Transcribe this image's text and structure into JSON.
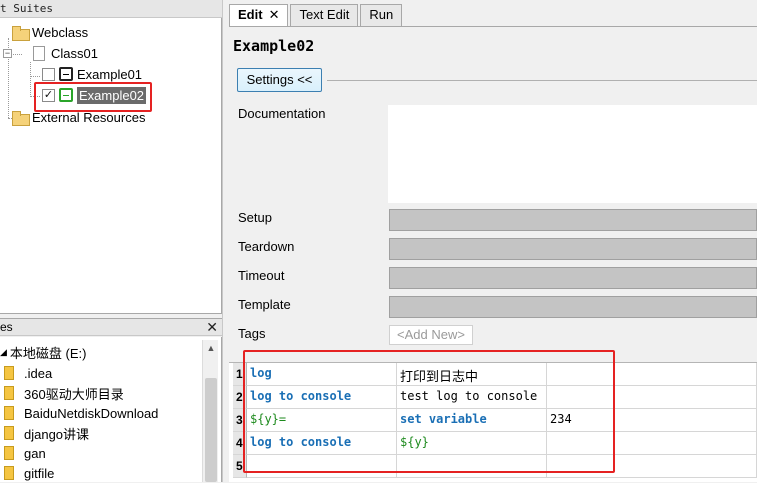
{
  "tree": {
    "header": "t Suites",
    "nodes": {
      "webclass": "Webclass",
      "class01": "Class01",
      "example01": "Example01",
      "example02": "Example02",
      "external": "External Resources"
    }
  },
  "files": {
    "header": "es",
    "drive": "本地磁盘 (E:)",
    "items": [
      ".idea",
      "360驱动大师目录",
      "BaiduNetdiskDownload",
      "django讲课",
      "gan",
      "gitfile"
    ]
  },
  "tabs": {
    "edit": "Edit",
    "text_edit": "Text Edit",
    "run": "Run"
  },
  "editor": {
    "test_name": "Example02",
    "settings_button": "Settings <<",
    "labels": {
      "documentation": "Documentation",
      "setup": "Setup",
      "teardown": "Teardown",
      "timeout": "Timeout",
      "template": "Template",
      "tags": "Tags"
    },
    "tags_placeholder": "<Add New>"
  },
  "grid": {
    "row_numbers": [
      "1",
      "2",
      "3",
      "4",
      "5"
    ],
    "rows": [
      [
        "log",
        "打印到日志中",
        ""
      ],
      [
        "log to console",
        "test log to console",
        ""
      ],
      [
        "${y}=",
        "set variable",
        "234"
      ],
      [
        "log to console",
        "${y}",
        ""
      ],
      [
        "",
        "",
        ""
      ]
    ]
  }
}
